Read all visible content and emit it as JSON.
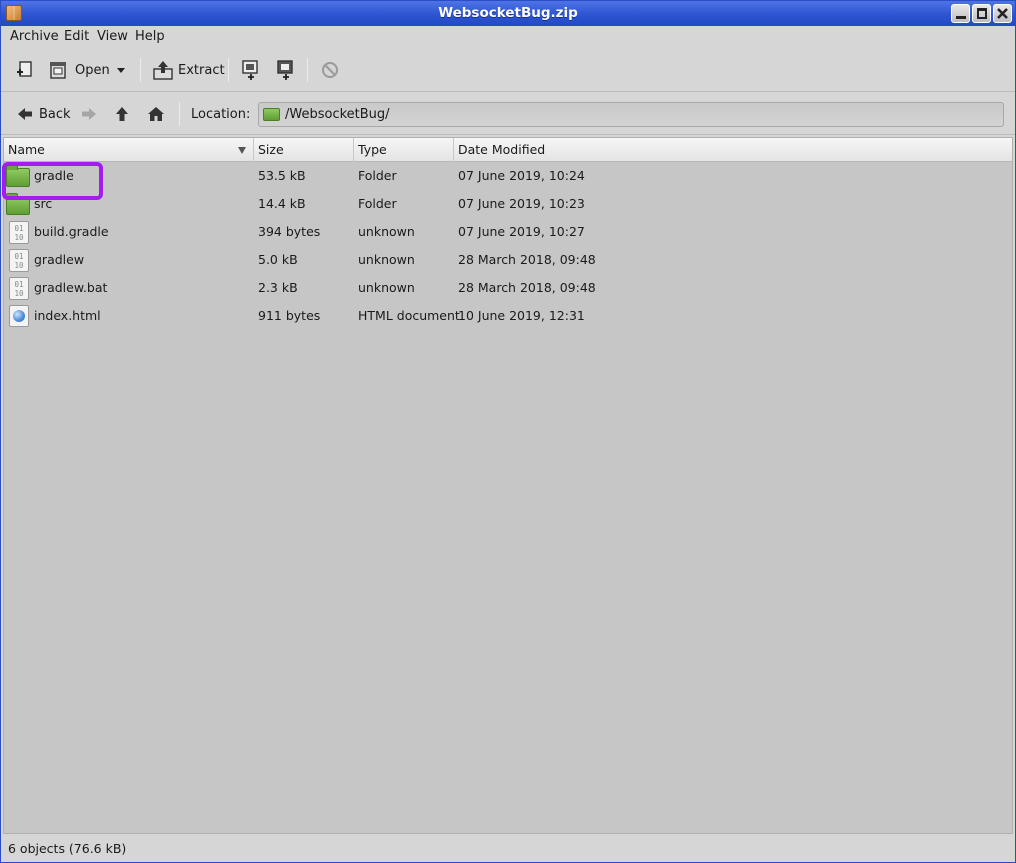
{
  "window": {
    "title": "WebsocketBug.zip"
  },
  "menubar": {
    "items": [
      "Archive",
      "Edit",
      "View",
      "Help"
    ]
  },
  "toolbar": {
    "open_label": "Open",
    "extract_label": "Extract"
  },
  "navigation": {
    "back_label": "Back",
    "location_label": "Location:",
    "location_value": "/WebsocketBug/"
  },
  "columns": {
    "name": "Name",
    "size": "Size",
    "type": "Type",
    "date": "Date Modified"
  },
  "files": [
    {
      "name": "gradle",
      "size": "53.5 kB",
      "type": "Folder",
      "date": "07 June 2019, 10:24",
      "icon": "folder-icon"
    },
    {
      "name": "src",
      "size": "14.4 kB",
      "type": "Folder",
      "date": "07 June 2019, 10:23",
      "icon": "folder-icon"
    },
    {
      "name": "build.gradle",
      "size": "394 bytes",
      "type": "unknown",
      "date": "07 June 2019, 10:27",
      "icon": "binary-file-icon"
    },
    {
      "name": "gradlew",
      "size": "5.0 kB",
      "type": "unknown",
      "date": "28 March 2018, 09:48",
      "icon": "binary-file-icon"
    },
    {
      "name": "gradlew.bat",
      "size": "2.3 kB",
      "type": "unknown",
      "date": "28 March 2018, 09:48",
      "icon": "binary-file-icon"
    },
    {
      "name": "index.html",
      "size": "911 bytes",
      "type": "HTML document",
      "date": "10 June 2019, 12:31",
      "icon": "html-file-icon"
    }
  ],
  "binary_icon_text": [
    "01",
    "10"
  ],
  "status": {
    "text": "6 objects (76.6 kB)"
  },
  "colors": {
    "titlebar": "#2d55d2",
    "highlight": "#a21cf0",
    "list_bg": "#c6c6c6"
  }
}
